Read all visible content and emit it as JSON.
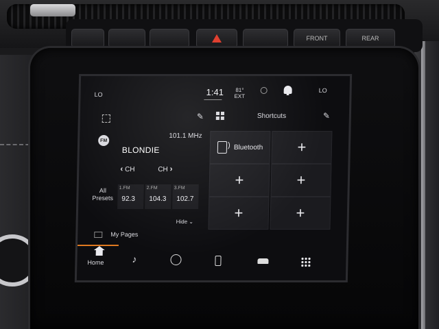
{
  "hardware": {
    "button_labels": [
      "",
      "",
      "",
      "",
      "",
      "FRONT",
      "REAR"
    ],
    "accent_hazard": "#e04030"
  },
  "status_bar": {
    "left_temp_label": "LO",
    "time": "1:41",
    "outside_temp": "81°",
    "outside_temp_label": "EXT",
    "right_temp_label": "LO",
    "icons": [
      "notification-bell-icon"
    ]
  },
  "radio": {
    "band": "FM",
    "frequency": "101.1 MHz",
    "station_name": "BLONDIE",
    "ch_prev_label": "CH",
    "ch_next_label": "CH",
    "presets_label": [
      "All",
      "Presets"
    ],
    "presets": [
      {
        "band": "1.FM",
        "value": "92.3"
      },
      {
        "band": "2.FM",
        "value": "104.3"
      },
      {
        "band": "3.FM",
        "value": "102.7"
      }
    ],
    "hide_label": "Hide"
  },
  "shortcuts": {
    "title": "Shortcuts",
    "tiles": [
      {
        "label": "Bluetooth",
        "type": "bluetooth"
      },
      {
        "label": "+",
        "type": "add"
      },
      {
        "label": "+",
        "type": "add"
      },
      {
        "label": "+",
        "type": "add"
      },
      {
        "label": "+",
        "type": "add"
      },
      {
        "label": "+",
        "type": "add"
      }
    ]
  },
  "my_pages_label": "My Pages",
  "nav": {
    "home_label": "Home",
    "accent": "#e07a20",
    "items": [
      "media-note-icon",
      "gauge-icon",
      "phone-icon",
      "vehicle-icon",
      "apps-grid-icon"
    ]
  },
  "glyphs": {
    "pencil": "✎",
    "note": "♪",
    "chev_left": "‹",
    "chev_right": "›",
    "chev_down": "⌄"
  }
}
